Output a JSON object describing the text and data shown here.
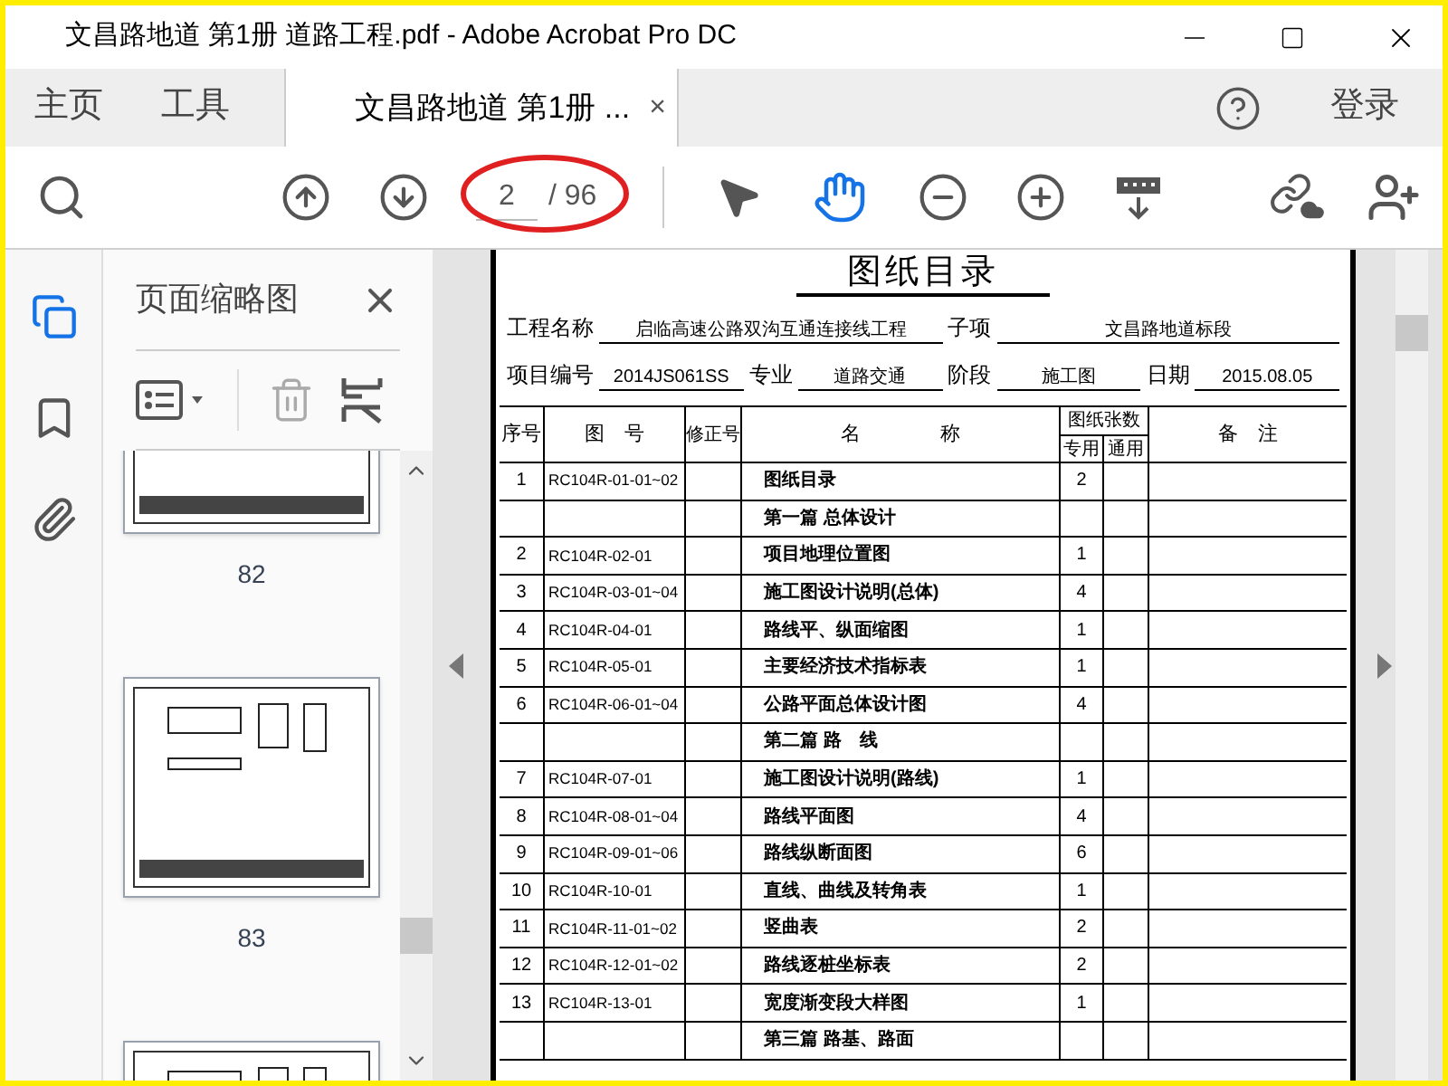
{
  "window": {
    "title": "文昌路地道 第1册 道路工程.pdf - Adobe Acrobat Pro DC"
  },
  "tabs": [
    {
      "label": "主页",
      "kind": "nav",
      "selected": false
    },
    {
      "label": "工具",
      "kind": "nav",
      "selected": false
    },
    {
      "label": "文昌路地道 第1册 ...",
      "kind": "document",
      "selected": true,
      "close": "×"
    }
  ],
  "account": {
    "sign_in": "登录"
  },
  "toolbar": {
    "page_value": "2",
    "page_total": "/ 96",
    "hand_tool_selected": true
  },
  "thumbnails": {
    "title": "页面缩略图",
    "pages": [
      {
        "label": "82"
      },
      {
        "label": "83"
      }
    ]
  },
  "document": {
    "title": "图纸目录",
    "fields": [
      [
        {
          "label": "工程名称",
          "value": "启临高速公路双沟互通连接线工程"
        },
        {
          "label": "子项",
          "value": "文昌路地道标段"
        }
      ],
      [
        {
          "label": "项目编号",
          "value": "2014JS061SS"
        },
        {
          "label": "专业",
          "value": "道路交通"
        },
        {
          "label": "阶段",
          "value": "施工图"
        },
        {
          "label": "日期",
          "value": "2015.08.05"
        }
      ]
    ],
    "columns": {
      "no": "序号",
      "drawing_no": "图　号",
      "revision": "修正号",
      "name": "名　　　　称",
      "sheets": "图纸张数",
      "special": "专用",
      "general": "通用",
      "note": "备　注"
    },
    "rows": [
      {
        "kind": "item",
        "no": "1",
        "drawing_no": "RC104R-01-01~02",
        "name": "图纸目录",
        "special": "2"
      },
      {
        "kind": "section",
        "name": "第一篇 总体设计"
      },
      {
        "kind": "item",
        "no": "2",
        "drawing_no": "RC104R-02-01",
        "name": "项目地理位置图",
        "special": "1"
      },
      {
        "kind": "item",
        "no": "3",
        "drawing_no": "RC104R-03-01~04",
        "name": "施工图设计说明(总体)",
        "special": "4"
      },
      {
        "kind": "item",
        "no": "4",
        "drawing_no": "RC104R-04-01",
        "name": "路线平、纵面缩图",
        "special": "1"
      },
      {
        "kind": "item",
        "no": "5",
        "drawing_no": "RC104R-05-01",
        "name": "主要经济技术指标表",
        "special": "1"
      },
      {
        "kind": "item",
        "no": "6",
        "drawing_no": "RC104R-06-01~04",
        "name": "公路平面总体设计图",
        "special": "4"
      },
      {
        "kind": "section",
        "name": "第二篇 路　线"
      },
      {
        "kind": "item",
        "no": "7",
        "drawing_no": "RC104R-07-01",
        "name": "施工图设计说明(路线)",
        "special": "1"
      },
      {
        "kind": "item",
        "no": "8",
        "drawing_no": "RC104R-08-01~04",
        "name": "路线平面图",
        "special": "4"
      },
      {
        "kind": "item",
        "no": "9",
        "drawing_no": "RC104R-09-01~06",
        "name": "路线纵断面图",
        "special": "6"
      },
      {
        "kind": "item",
        "no": "10",
        "drawing_no": "RC104R-10-01",
        "name": "直线、曲线及转角表",
        "special": "1"
      },
      {
        "kind": "item",
        "no": "11",
        "drawing_no": "RC104R-11-01~02",
        "name": "竖曲表",
        "special": "2"
      },
      {
        "kind": "item",
        "no": "12",
        "drawing_no": "RC104R-12-01~02",
        "name": "路线逐桩坐标表",
        "special": "2"
      },
      {
        "kind": "item",
        "no": "13",
        "drawing_no": "RC104R-13-01",
        "name": "宽度渐变段大样图",
        "special": "1"
      },
      {
        "kind": "section",
        "name": "第三篇 路基、路面"
      }
    ]
  }
}
